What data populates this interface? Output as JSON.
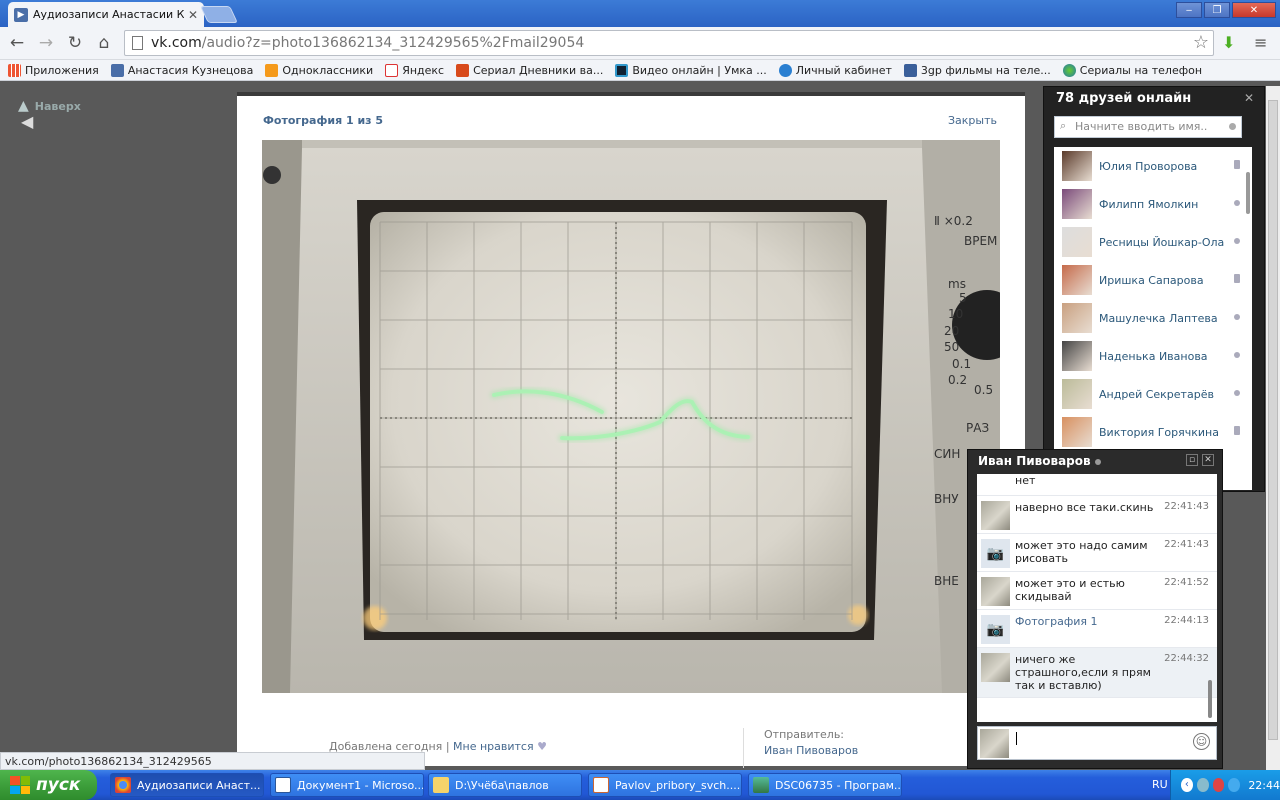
{
  "browser": {
    "tab_title": "Аудиозаписи Анастасии Ку",
    "url_host": "vk.com",
    "url_rest": "/audio?z=photo136862134_312429565%2Fmail29054",
    "bookmarks": [
      "Приложения",
      "Анастасия Кузнецова",
      "Одноклассники",
      "Яндекс",
      "Сериал Дневники ва...",
      "Видео онлайн | Умка ...",
      "Личный кабинет",
      "3gp фильмы на теле...",
      "Сериалы на телефон"
    ]
  },
  "page": {
    "up_label": "Наверх"
  },
  "viewer": {
    "counter": "Фотография 1 из 5",
    "close_label": "Закрыть",
    "added_label": "Добавлена сегодня",
    "separator": "|",
    "like_label": "Мне нравится",
    "sender_label": "Отправитель:",
    "sender_name": "Иван Пивоваров"
  },
  "friends": {
    "title": "78 друзей онлайн",
    "search_placeholder": "Начните вводить имя..",
    "items": [
      {
        "name": "Юлия Проворова",
        "status": "mobile"
      },
      {
        "name": "Филипп Ямолкин",
        "status": "online"
      },
      {
        "name": "Ресницы Йошкар-Ола",
        "status": "online"
      },
      {
        "name": "Иришка Сапарова",
        "status": "mobile"
      },
      {
        "name": "Машулечка Лаптева",
        "status": "online"
      },
      {
        "name": "Наденька Иванова",
        "status": "online"
      },
      {
        "name": "Андрей Секретарёв",
        "status": "online"
      },
      {
        "name": "Виктория Горячкина",
        "status": "mobile"
      }
    ]
  },
  "chat": {
    "title": "Иван Пивоваров",
    "top_text": "нет",
    "messages": [
      {
        "text": "наверно все таки.скинь",
        "time": "22:41:43",
        "avatar": "photo"
      },
      {
        "text": "может это надо самим рисовать",
        "time": "22:41:43",
        "avatar": "camera"
      },
      {
        "text": "может это и естью скидывай",
        "time": "22:41:52",
        "avatar": "photo"
      },
      {
        "text": "Фотография 1",
        "time": "22:44:13",
        "avatar": "camera"
      },
      {
        "text": "ничего же страшного,если я прям так и вставлю)",
        "time": "22:44:32",
        "avatar": "photo"
      }
    ]
  },
  "statusbar": {
    "text": "vk.com/photo136862134_312429565"
  },
  "taskbar": {
    "start_label": "пуск",
    "buttons": [
      "Аудиозаписи Анаст...",
      "Документ1 - Microso...",
      "D:\\Учёба\\павлов",
      "Pavlov_pribory_svch....",
      "DSC06735 - Програм..."
    ],
    "lang": "RU",
    "clock": "22:44"
  },
  "colors": {
    "accent": "#45688e",
    "start_green": "#3a9b38",
    "taskbar_blue": "#245edb"
  }
}
